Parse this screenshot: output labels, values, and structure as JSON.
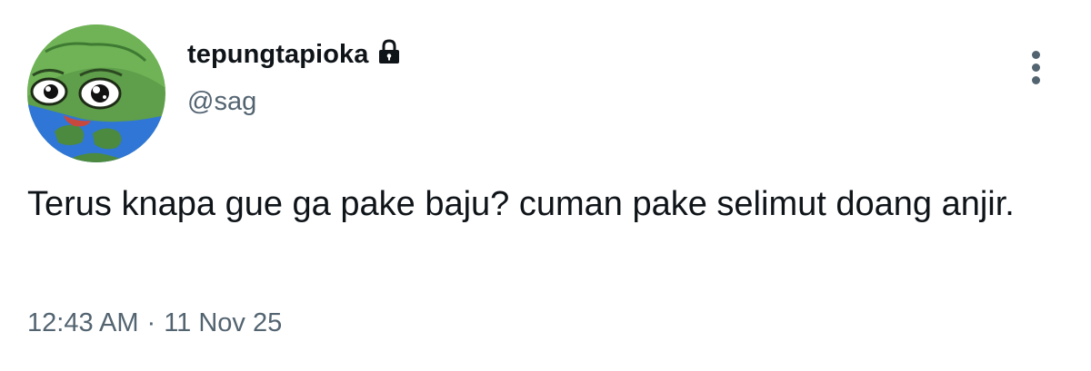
{
  "user": {
    "display_name": "tepungtapioka",
    "handle": "@sag",
    "protected_icon": "lock-icon",
    "avatar_icon": "pepe-frog-avatar"
  },
  "tweet": {
    "text": "Terus knapa gue ga pake baju? cuman pake selimut doang anjir.",
    "time": "12:43 AM",
    "separator": "·",
    "date": "11 Nov 25"
  },
  "actions": {
    "more_icon": "more-vertical-icon"
  },
  "colors": {
    "primary_text": "#0f1419",
    "secondary_text": "#536471",
    "background": "#ffffff"
  }
}
